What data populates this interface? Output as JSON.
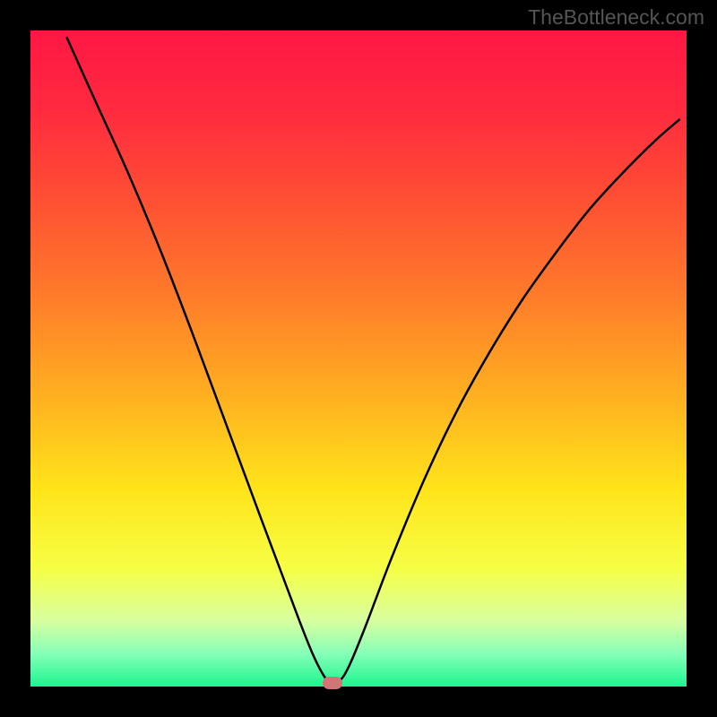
{
  "watermark": "TheBottleneck.com",
  "chart_data": {
    "type": "line",
    "title": "",
    "xlabel": "",
    "ylabel": "",
    "xlim": [
      0,
      100
    ],
    "ylim": [
      0,
      100
    ],
    "curve": [
      {
        "x": 5.5,
        "y": 99.0
      },
      {
        "x": 10.0,
        "y": 89.0
      },
      {
        "x": 15.0,
        "y": 78.0
      },
      {
        "x": 20.0,
        "y": 66.0
      },
      {
        "x": 25.0,
        "y": 53.0
      },
      {
        "x": 30.0,
        "y": 39.5
      },
      {
        "x": 35.0,
        "y": 26.0
      },
      {
        "x": 38.0,
        "y": 18.0
      },
      {
        "x": 41.0,
        "y": 10.0
      },
      {
        "x": 43.0,
        "y": 5.0
      },
      {
        "x": 44.5,
        "y": 2.0
      },
      {
        "x": 45.5,
        "y": 0.8
      },
      {
        "x": 47.0,
        "y": 0.8
      },
      {
        "x": 48.5,
        "y": 3.0
      },
      {
        "x": 51.0,
        "y": 9.0
      },
      {
        "x": 55.0,
        "y": 19.5
      },
      {
        "x": 60.0,
        "y": 31.5
      },
      {
        "x": 65.0,
        "y": 42.0
      },
      {
        "x": 70.0,
        "y": 51.0
      },
      {
        "x": 75.0,
        "y": 59.0
      },
      {
        "x": 80.0,
        "y": 66.0
      },
      {
        "x": 85.0,
        "y": 72.5
      },
      {
        "x": 90.0,
        "y": 78.0
      },
      {
        "x": 95.0,
        "y": 83.0
      },
      {
        "x": 99.0,
        "y": 86.5
      }
    ],
    "bottleneck_marker": {
      "x": 46.0,
      "y": 0.5
    },
    "gradient_stops": [
      {
        "offset": 0.0,
        "color": "#ff1744"
      },
      {
        "offset": 0.12,
        "color": "#ff2a3f"
      },
      {
        "offset": 0.25,
        "color": "#ff4d34"
      },
      {
        "offset": 0.4,
        "color": "#ff7a2a"
      },
      {
        "offset": 0.55,
        "color": "#ffad21"
      },
      {
        "offset": 0.7,
        "color": "#ffe41a"
      },
      {
        "offset": 0.82,
        "color": "#f6ff45"
      },
      {
        "offset": 0.9,
        "color": "#d8ffa0"
      },
      {
        "offset": 0.95,
        "color": "#85ffb8"
      },
      {
        "offset": 1.0,
        "color": "#1cf58f"
      }
    ],
    "background": "#000000",
    "curve_color": "#000000",
    "marker_color": "#cf7676"
  }
}
